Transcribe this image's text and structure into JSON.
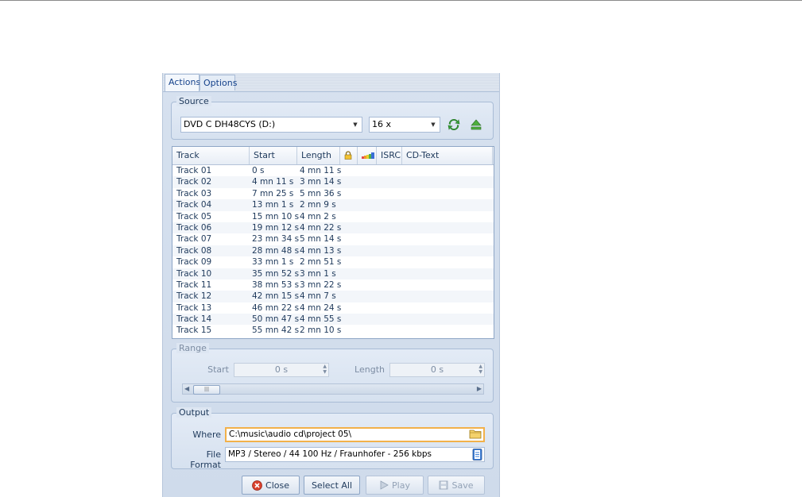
{
  "tabs": [
    {
      "label": "Actions",
      "active": true
    },
    {
      "label": "Options",
      "active": false
    }
  ],
  "source": {
    "title": "Source",
    "drive": "DVD C  DH48CYS (D:)",
    "speed": "16 x",
    "refresh_icon": "refresh-icon",
    "eject_icon": "eject-icon"
  },
  "tracks": {
    "columns": [
      "Track",
      "Start",
      "Length",
      "",
      "",
      "ISRC",
      "CD-Text"
    ],
    "rows": [
      {
        "track": "Track 01",
        "start": "0 s",
        "length": "4 mn 11 s"
      },
      {
        "track": "Track 02",
        "start": "4 mn 11 s",
        "length": "3 mn 14 s"
      },
      {
        "track": "Track 03",
        "start": "7 mn 25 s",
        "length": "5 mn 36 s"
      },
      {
        "track": "Track 04",
        "start": "13 mn 1 s",
        "length": "2 mn 9 s"
      },
      {
        "track": "Track 05",
        "start": "15 mn 10 s",
        "length": "4 mn 2 s"
      },
      {
        "track": "Track 06",
        "start": "19 mn 12 s",
        "length": "4 mn 22 s"
      },
      {
        "track": "Track 07",
        "start": "23 mn 34 s",
        "length": "5 mn 14 s"
      },
      {
        "track": "Track 08",
        "start": "28 mn 48 s",
        "length": "4 mn 13 s"
      },
      {
        "track": "Track 09",
        "start": "33 mn 1 s",
        "length": "2 mn 51 s"
      },
      {
        "track": "Track 10",
        "start": "35 mn 52 s",
        "length": "3 mn 1 s"
      },
      {
        "track": "Track 11",
        "start": "38 mn 53 s",
        "length": "3 mn 22 s"
      },
      {
        "track": "Track 12",
        "start": "42 mn 15 s",
        "length": "4 mn 7 s"
      },
      {
        "track": "Track 13",
        "start": "46 mn 22 s",
        "length": "4 mn 24 s"
      },
      {
        "track": "Track 14",
        "start": "50 mn 47 s",
        "length": "4 mn 55 s"
      },
      {
        "track": "Track 15",
        "start": "55 mn 42 s",
        "length": "2 mn 10 s"
      }
    ]
  },
  "range": {
    "title": "Range",
    "start_label": "Start",
    "start_value": "0 s",
    "length_label": "Length",
    "length_value": "0 s"
  },
  "output": {
    "title": "Output",
    "where_label": "Where",
    "where_value": "C:\\music\\audio cd\\project 05\\",
    "format_label": "File Format",
    "format_value": "MP3 / Stereo / 44 100 Hz / Fraunhofer - 256 kbps"
  },
  "buttons": {
    "close": "Close",
    "select_all": "Select All",
    "play": "Play",
    "save": "Save"
  },
  "colors": {
    "accent": "#15428b",
    "focus_border": "#f2b14a",
    "close_red": "#d9412e",
    "refresh_green": "#3aa83a"
  }
}
